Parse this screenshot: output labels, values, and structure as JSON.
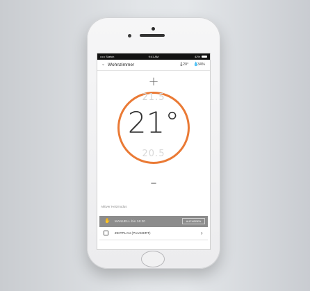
{
  "status_bar": {
    "carrier": "••••• Sketch",
    "time": "9:41 AM",
    "battery": "42%"
  },
  "header": {
    "title": "Wohnzimmer",
    "current_temp": "20°",
    "humidity": "34%"
  },
  "thermostat": {
    "upper_value": "21.5",
    "target_temp": "21°",
    "lower_value": "20.5",
    "accent_color": "#ea7a35"
  },
  "mode_section": {
    "label": "Aktiver Heizmodus",
    "manual_text": "MANUELL bis 16:20",
    "manual_button": "AUFHEBEN",
    "schedule_text": "ZEITPLAN (PAUSIERT)"
  }
}
